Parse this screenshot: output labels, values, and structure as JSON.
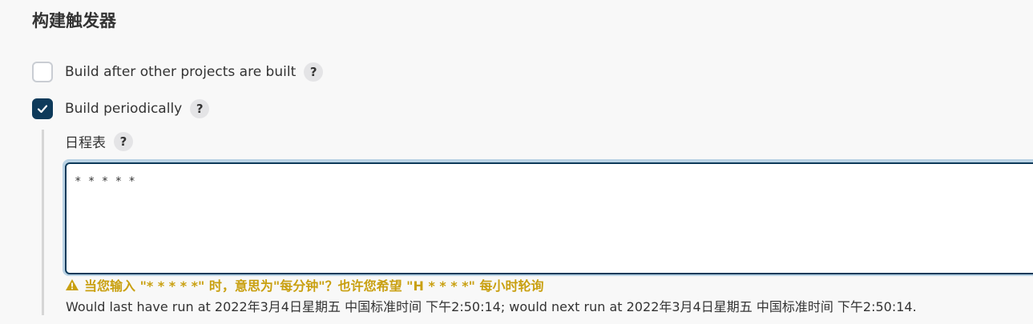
{
  "section": {
    "title": "构建触发器"
  },
  "options": {
    "build_after": {
      "label": "Build after other projects are built",
      "checked": false,
      "help": "?"
    },
    "build_periodically": {
      "label": "Build periodically",
      "checked": true,
      "help": "?"
    }
  },
  "schedule": {
    "label": "日程表",
    "help": "?",
    "value": "* * * * *",
    "warning": "当您输入 \"* * * * *\" 时，意思为\"每分钟\"？也许您希望 \"H * * * *\" 每小时轮询",
    "info": "Would last have run at 2022年3月4日星期五 中国标准时间 下午2:50:14; would next run at 2022年3月4日星期五 中国标准时间 下午2:50:14."
  },
  "colors": {
    "accent": "#0e3a5a",
    "warning": "#c9a010",
    "focus_ring": "#b9d2e4"
  }
}
